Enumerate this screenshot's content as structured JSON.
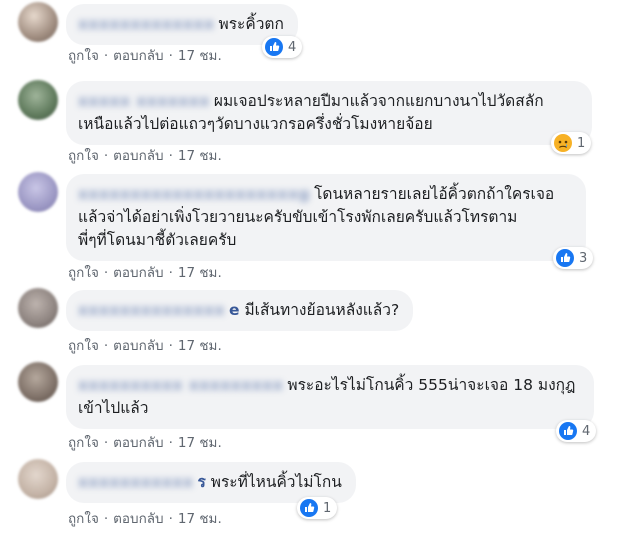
{
  "comments": [
    {
      "name_hidden": "xxxxxxxxxxxxx",
      "name_tail": "",
      "text_lines": [
        "พระคิ้วตก"
      ],
      "like_label": "ถูกใจ",
      "reply_label": "ตอบกลับ",
      "time": "17 ชม.",
      "reaction": {
        "icon": "like-icon",
        "count": "4"
      },
      "avatar_color": "#b9a79a"
    },
    {
      "name_hidden": "xxxxx xxxxxxx",
      "name_tail": "",
      "text_lines": [
        "ผมเจอประหลายปีมาแล้วจากแยกบางนาไปวัดสลัก",
        "เหนือแล้วไปต่อแถวๆวัดบางแวกรอครึ่งชั่วโมงหายจ้อย"
      ],
      "like_label": "ถูกใจ",
      "reply_label": "ตอบกลับ",
      "time": "17 ชม.",
      "reaction": {
        "icon": "sad-icon",
        "count": "1"
      },
      "avatar_color": "#6f8a6a"
    },
    {
      "name_hidden": "xxxxxxxxxxxxxxxxxxxxxg",
      "name_tail": "",
      "text_lines": [
        "โดนหลายรายเลยไอ้คิ้วตกถ้าใครเจอ",
        "แล้วจ่าได้อย่าเพิ่งโวยวายนะครับขับเข้าโรงพักเลยครับแล้วโทรตาม",
        "พี่ๆที่โดนมาชี้ตัวเลยครับ"
      ],
      "like_label": "ถูกใจ",
      "reply_label": "ตอบกลับ",
      "time": "17 ชม.",
      "reaction": {
        "icon": "like-icon",
        "count": "3"
      },
      "avatar_color": "#a6a3c8"
    },
    {
      "name_hidden": "xxxxxxxxxxxxxx",
      "name_tail": "e",
      "text_lines": [
        "มีเส้นทางย้อนหลังแล้ว?"
      ],
      "like_label": "ถูกใจ",
      "reply_label": "ตอบกลับ",
      "time": "17 ชม.",
      "reaction": null,
      "avatar_color": "#9a8f8a"
    },
    {
      "name_hidden": "xxxxxxxxxx xxxxxxxxx",
      "name_tail": "",
      "text_lines": [
        "พระอะไรไม่โกนคิ้ว 555น่าจะเจอ 18 มงกุฎ",
        "เข้าไปแล้ว"
      ],
      "like_label": "ถูกใจ",
      "reply_label": "ตอบกลับ",
      "time": "17 ชม.",
      "reaction": {
        "icon": "like-icon",
        "count": "4"
      },
      "avatar_color": "#8b7d72"
    },
    {
      "name_hidden": "xxxxxxxxxxx",
      "name_tail": "ร",
      "text_lines": [
        "พระที่ไหนคิ้วไม่โกน"
      ],
      "like_label": "ถูกใจ",
      "reply_label": "ตอบกลับ",
      "time": "17 ชม.",
      "reaction": {
        "icon": "like-icon",
        "count": "1"
      },
      "avatar_color": "#c9b9ad"
    }
  ],
  "colors": {
    "bubble": "#f2f3f5",
    "name": "#385898",
    "meta": "#606770",
    "like_blue": "#1877f2",
    "sad_yellow": "#f7b125"
  }
}
